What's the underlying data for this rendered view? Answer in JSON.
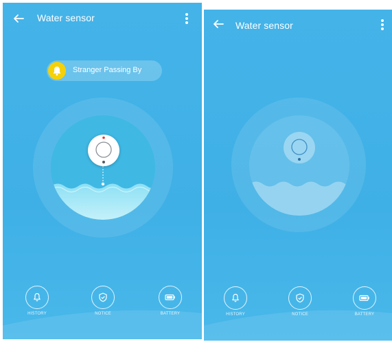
{
  "screens": [
    {
      "header": {
        "title": "Water sensor"
      },
      "alert": {
        "text": "Stranger Passing By",
        "icon": "bell-icon",
        "icon_color": "#f5d10a"
      },
      "nav": [
        {
          "label": "HISTORY",
          "icon": "bell-icon"
        },
        {
          "label": "NOTICE",
          "icon": "shield-check-icon"
        },
        {
          "label": "BATTERY",
          "icon": "battery-icon"
        }
      ],
      "indicator_color": "#e53935"
    },
    {
      "header": {
        "title": "Water sensor"
      },
      "nav": [
        {
          "label": "HISTORY",
          "icon": "bell-icon"
        },
        {
          "label": "NOTICE",
          "icon": "shield-check-icon"
        },
        {
          "label": "BATTERY",
          "icon": "battery-icon"
        }
      ]
    }
  ],
  "colors": {
    "background": "#44b3e8",
    "water": "#b8ecf7",
    "accent_alert": "#f5d10a"
  }
}
